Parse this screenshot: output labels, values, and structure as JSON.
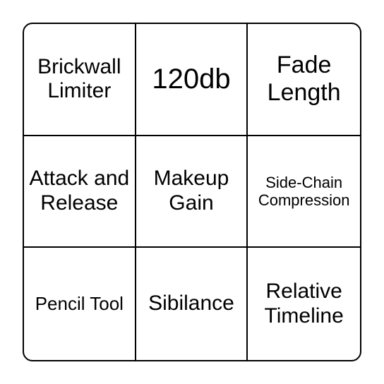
{
  "grid": {
    "cells": [
      {
        "label": "Brickwall Limiter",
        "size": "s-md"
      },
      {
        "label": "120db",
        "size": "s-xl"
      },
      {
        "label": "Fade Length",
        "size": "s-lg"
      },
      {
        "label": "Attack and Release",
        "size": "s-md"
      },
      {
        "label": "Makeup Gain",
        "size": "s-md"
      },
      {
        "label": "Side-Chain Compression",
        "size": "s-xs"
      },
      {
        "label": "Pencil Tool",
        "size": "s-sm"
      },
      {
        "label": "Sibilance",
        "size": "s-md"
      },
      {
        "label": "Relative Timeline",
        "size": "s-md"
      }
    ]
  }
}
